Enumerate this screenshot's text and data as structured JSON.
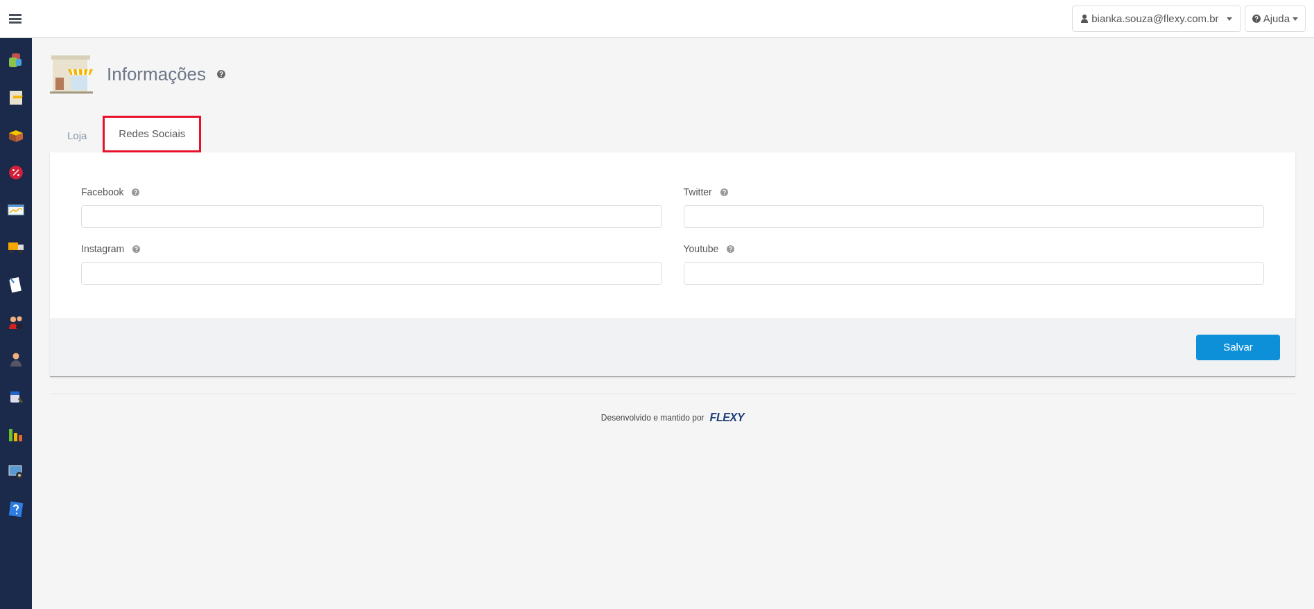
{
  "header": {
    "user_menu": "bianka.souza@flexy.com.br",
    "help_menu": "Ajuda"
  },
  "page": {
    "title": "Informações"
  },
  "tabs": [
    {
      "label": "Loja",
      "selected": false,
      "highlighted": false
    },
    {
      "label": "Redes Sociais",
      "selected": true,
      "highlighted": true
    }
  ],
  "fields": [
    {
      "label": "Facebook"
    },
    {
      "label": "Twitter"
    },
    {
      "label": "Instagram"
    },
    {
      "label": "Youtube"
    }
  ],
  "save_button": "Salvar",
  "footer": {
    "text": "Desenvolvido e mantido por",
    "brand": "FLEXY"
  }
}
